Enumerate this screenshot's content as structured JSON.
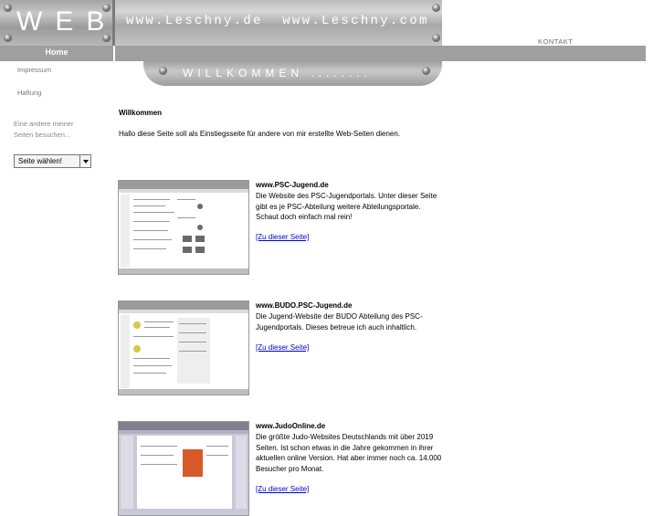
{
  "header": {
    "logo_text": "WEB",
    "url_text": "www.Leschny.de  www.Leschny.com",
    "kontakt": "KONTAKT"
  },
  "nav": {
    "home": "Home"
  },
  "banner": {
    "text": "WILLKOMMEN ........"
  },
  "sidebar": {
    "links": [
      "Impressum",
      "Haftung"
    ],
    "text_line1": "Eine andere meiner",
    "text_line2": "Seiten besuchen...",
    "select_value": "Seite wählen!"
  },
  "content": {
    "title": "Willkommen",
    "intro": "Hallo diese Seite soll als Einstiegsseite für andere von mir erstellte Web-Seiten dienen.",
    "entries": [
      {
        "title": "www.PSC-Jugend.de",
        "description": "Die Website des PSC-Jugendportals. Unter dieser Seite gibt es je PSC-Abteilung weitere Abteilungsportale. Schaut doch einfach mal rein!",
        "link": "[Zu dieser Seite]"
      },
      {
        "title": "www.BUDO.PSC-Jugend.de",
        "description": "Die Jugend-Website der BUDO Abteilung des PSC-Jugendportals. Dieses betreue ich auch inhaltlich.",
        "link": "[Zu dieser Seite]"
      },
      {
        "title": "www.JudoOnline.de",
        "description": "Die größte Judo-Websites Deutschlands mit über 2019 Seiten. Ist schon etwas in die Jahre gekommen in ihrer aktuellen online Version. Hat aber immer noch ca. 14.000 Besucher pro Monat.",
        "link": "[Zu dieser Seite]"
      }
    ]
  },
  "colors": {
    "nav_bar": "#9f9f9f",
    "link": "#0000cc"
  }
}
